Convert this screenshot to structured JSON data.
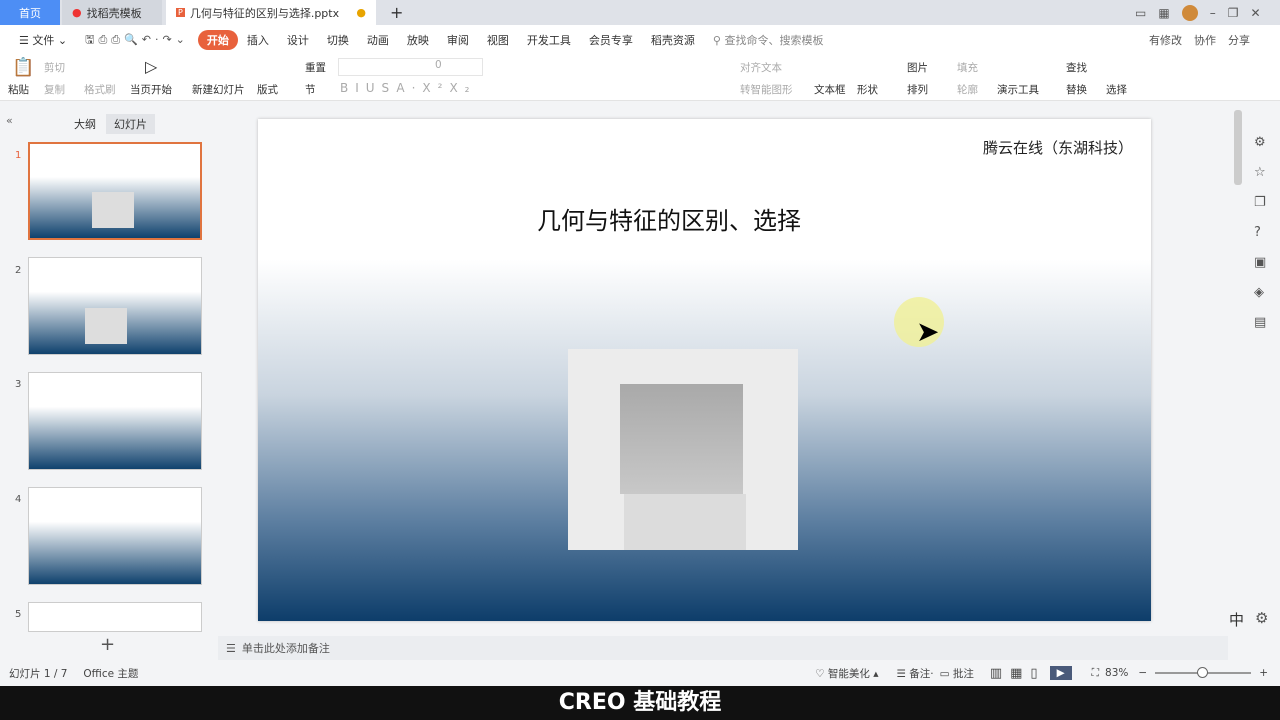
{
  "tabs": [
    {
      "label": "首页"
    },
    {
      "label": "找稻壳模板"
    },
    {
      "label": "几何与特征的区别与选择.pptx"
    }
  ],
  "new_tab": "+",
  "menu": {
    "file": "文件",
    "items": [
      "开始",
      "插入",
      "设计",
      "切换",
      "动画",
      "放映",
      "审阅",
      "视图",
      "开发工具",
      "会员专享",
      "稻壳资源"
    ],
    "search": "查找命令、搜索模板",
    "right": [
      "有修改",
      "协作",
      "分享"
    ]
  },
  "ribbon": {
    "paste": "粘贴",
    "cut": "剪切",
    "copy": "复制",
    "format_painter": "格式刷",
    "play_from_current": "当页开始",
    "new_slide": "新建幻灯片",
    "layout": "版式",
    "reset": "重置",
    "section": "节",
    "font_size": "0",
    "align_text": "对齐文本",
    "smart_shape": "转智能图形",
    "textbox": "文本框",
    "shape": "形状",
    "picture": "图片",
    "arrange": "排列",
    "fill": "填充",
    "outline": "轮廓",
    "presenter_tools": "演示工具",
    "find": "查找",
    "replace": "替换",
    "select": "选择"
  },
  "panel": {
    "tab_outline": "大纲",
    "tab_slides": "幻灯片",
    "slides": [
      "1",
      "2",
      "3",
      "4",
      "5"
    ],
    "add": "+"
  },
  "slide": {
    "header": "腾云在线（东湖科技）",
    "title": "几何与特征的区别、选择"
  },
  "notes_placeholder": "单击此处添加备注",
  "status": {
    "slide_count": "幻灯片 1 / 7",
    "theme": "Office 主题",
    "beautify": "智能美化",
    "notes": "备注",
    "comment": "批注",
    "zoom": "83%"
  },
  "caption": "CREO 基础教程",
  "ime": "中",
  "colors": {
    "accent": "#e8613c",
    "slide_bottom": "#0d3d6a"
  }
}
